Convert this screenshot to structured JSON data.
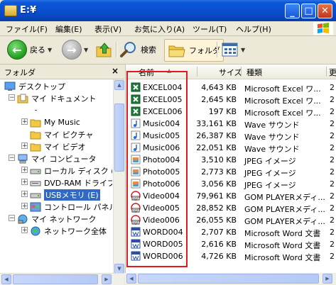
{
  "window": {
    "title": "E:¥"
  },
  "menu": [
    "ファイル(F)",
    "編集(E)",
    "表示(V)",
    "お気に入り(A)",
    "ツール(T)",
    "ヘルプ(H)"
  ],
  "toolbar": {
    "back": "戻る",
    "search": "検索",
    "folders": "フォルダ"
  },
  "left_pane": {
    "title": "フォルダ",
    "close": "×",
    "tree": [
      {
        "label": "デスクトップ",
        "icon": "desktop-icon"
      },
      {
        "label": "マイ ドキュメント",
        "icon": "my-documents-icon"
      },
      {
        "label": "",
        "icon": "folder-icon"
      },
      {
        "label": "My Music",
        "icon": "folder-icon"
      },
      {
        "label": "マイ ピクチャ",
        "icon": "folder-icon"
      },
      {
        "label": "マイ ビデオ",
        "icon": "folder-icon"
      },
      {
        "label": "マイ コンピュータ",
        "icon": "my-computer-icon"
      },
      {
        "label": "ローカル ディスク (C",
        "icon": "hard-disk-icon"
      },
      {
        "label": "DVD-RAM ドライブ",
        "icon": "dvd-drive-icon"
      },
      {
        "label": "USBメモリ (E)",
        "icon": "usb-drive-icon"
      },
      {
        "label": "コントロール パネル",
        "icon": "control-panel-icon"
      },
      {
        "label": "マイ ネットワーク",
        "icon": "network-icon"
      },
      {
        "label": "ネットワーク全体",
        "icon": "globe-icon"
      }
    ]
  },
  "columns": {
    "name": "名前",
    "size": "サイズ",
    "type": "種類",
    "extra": "更"
  },
  "files": [
    {
      "name": "EXCEL004",
      "size": "4,643 KB",
      "type": "Microsoft Excel ワ...",
      "icon": "excel-file-icon",
      "extra": "2"
    },
    {
      "name": "EXCEL005",
      "size": "2,645 KB",
      "type": "Microsoft Excel ワ...",
      "icon": "excel-file-icon",
      "extra": "2"
    },
    {
      "name": "EXCEL006",
      "size": "197 KB",
      "type": "Microsoft Excel ワ...",
      "icon": "excel-file-icon",
      "extra": "2"
    },
    {
      "name": "Music004",
      "size": "33,161 KB",
      "type": "Wave サウンド",
      "icon": "music-file-icon",
      "extra": "2"
    },
    {
      "name": "Music005",
      "size": "26,387 KB",
      "type": "Wave サウンド",
      "icon": "music-file-icon",
      "extra": "2"
    },
    {
      "name": "Music006",
      "size": "22,051 KB",
      "type": "Wave サウンド",
      "icon": "music-file-icon",
      "extra": "2"
    },
    {
      "name": "Photo004",
      "size": "3,510 KB",
      "type": "JPEG イメージ",
      "icon": "photo-file-icon",
      "extra": "2"
    },
    {
      "name": "Photo005",
      "size": "2,773 KB",
      "type": "JPEG イメージ",
      "icon": "photo-file-icon",
      "extra": "2"
    },
    {
      "name": "Photo006",
      "size": "3,056 KB",
      "type": "JPEG イメージ",
      "icon": "photo-file-icon",
      "extra": "2"
    },
    {
      "name": "Video004",
      "size": "79,961 KB",
      "type": "GOM PLAYERメディ...",
      "icon": "video-file-icon",
      "extra": "2"
    },
    {
      "name": "Video005",
      "size": "28,852 KB",
      "type": "GOM PLAYERメディ...",
      "icon": "video-file-icon",
      "extra": "2"
    },
    {
      "name": "Video006",
      "size": "26,055 KB",
      "type": "GOM PLAYERメディ...",
      "icon": "video-file-icon",
      "extra": "2"
    },
    {
      "name": "WORD004",
      "size": "2,707 KB",
      "type": "Microsoft Word 文書",
      "icon": "word-file-icon",
      "extra": "2"
    },
    {
      "name": "WORD005",
      "size": "2,616 KB",
      "type": "Microsoft Word 文書",
      "icon": "word-file-icon",
      "extra": "2"
    },
    {
      "name": "WORD006",
      "size": "4,726 KB",
      "type": "Microsoft Word 文書",
      "icon": "word-file-icon",
      "extra": "2"
    }
  ],
  "colors": {
    "selection": "#316AC5",
    "highlight_box": "#E0191E",
    "titlebar": "#0A4FD0"
  }
}
